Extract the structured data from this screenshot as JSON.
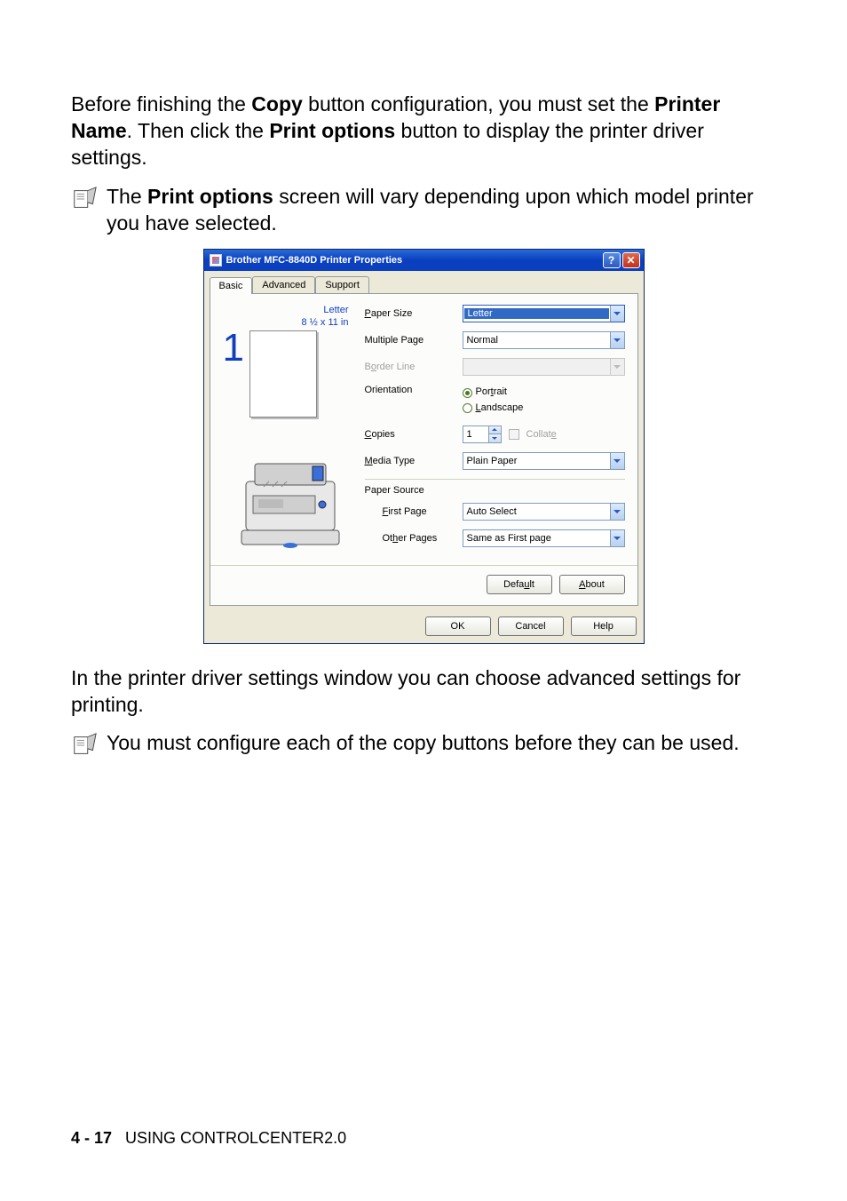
{
  "para1_pre": "Before finishing the ",
  "para1_b1": "Copy",
  "para1_mid1": " button configuration, you must set the ",
  "para1_b2": "Printer Name",
  "para1_mid2": ". Then click the ",
  "para1_b3": "Print options",
  "para1_post": " button to display the printer driver settings.",
  "note1_pre": "The ",
  "note1_b": "Print options",
  "note1_post": " screen will vary depending upon which model printer you have selected.",
  "para2": "In the printer driver settings window you can choose advanced settings for printing.",
  "note2": "You must configure each of the copy buttons before they can be used.",
  "footer_page": "4 - 17",
  "footer_text": "USING CONTROLCENTER2.0",
  "dialog": {
    "title": "Brother MFC-8840D Printer Properties",
    "tabs": {
      "basic": "Basic",
      "advanced": "Advanced",
      "support": "Support"
    },
    "preview": {
      "name": "Letter",
      "dims": "8 ½ x 11 in",
      "count": "1"
    },
    "labels": {
      "paperSize_pre": "P",
      "paperSize_post": "aper Size",
      "multiplePage": "Multiple Page",
      "borderLine_pre": "B",
      "borderLine_ul": "o",
      "borderLine_post": "rder Line",
      "orientation": "Orientation",
      "portrait_pre": "Por",
      "portrait_ul": "t",
      "portrait_post": "rait",
      "landscape_ul": "L",
      "landscape_post": "andscape",
      "copies_ul": "C",
      "copies_post": "opies",
      "collate_pre": "Collat",
      "collate_ul": "e",
      "mediaType_ul": "M",
      "mediaType_post": "edia Type",
      "paperSource": "Paper Source",
      "firstPage_ul": "F",
      "firstPage_post": "irst Page",
      "otherPages_pre": "Ot",
      "otherPages_ul": "h",
      "otherPages_post": "er Pages"
    },
    "values": {
      "paperSize": "Letter",
      "multiplePage": "Normal",
      "copies": "1",
      "mediaType": "Plain Paper",
      "firstPage": "Auto Select",
      "otherPages": "Same as First page"
    },
    "buttons": {
      "default_pre": "Defa",
      "default_ul": "u",
      "default_post": "lt",
      "about_ul": "A",
      "about_post": "bout",
      "ok": "OK",
      "cancel": "Cancel",
      "help": "Help"
    }
  }
}
